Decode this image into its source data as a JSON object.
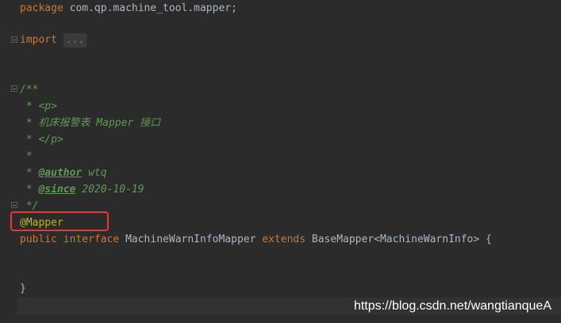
{
  "editor": {
    "package_keyword": "package",
    "package_name": " com.qp.machine_tool.mapper;",
    "import_keyword": "import",
    "import_fold": "...",
    "doc_open": "/**",
    "doc_p_open": " * <p>",
    "doc_desc": " * 机床报警表 Mapper 接口",
    "doc_p_close": " * </p>",
    "doc_star": " *",
    "doc_author_prefix": " * ",
    "doc_author_tag": "@author",
    "doc_author_value": " wtq",
    "doc_since_prefix": " * ",
    "doc_since_tag": "@since",
    "doc_since_value": " 2020-10-19",
    "doc_close": " */",
    "annotation": "@Mapper",
    "decl_public": "public",
    "decl_interface": " interface",
    "decl_name": " MachineWarnInfoMapper ",
    "decl_extends": "extends",
    "decl_rest": " BaseMapper<MachineWarnInfo> {",
    "closing_brace": "}"
  },
  "watermark": "https://blog.csdn.net/wangtianqueA"
}
